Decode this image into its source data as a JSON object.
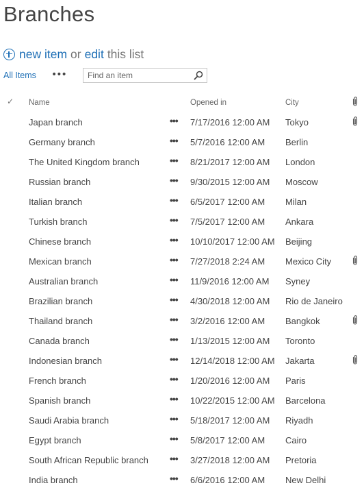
{
  "page": {
    "title": "Branches"
  },
  "commands": {
    "new_item": "new item",
    "or": "or",
    "edit": "edit",
    "this_list": "this list"
  },
  "views": {
    "all_items": "All Items",
    "more": "•••",
    "search_placeholder": "Find an item"
  },
  "columns": {
    "name": "Name",
    "opened_in": "Opened in",
    "city": "City"
  },
  "rows": [
    {
      "name": "Japan branch",
      "opened": "7/17/2016 12:00 AM",
      "city": "Tokyo",
      "attachment": true
    },
    {
      "name": "Germany branch",
      "opened": "5/7/2016 12:00 AM",
      "city": "Berlin",
      "attachment": false
    },
    {
      "name": "The United Kingdom branch",
      "opened": "8/21/2017 12:00 AM",
      "city": "London",
      "attachment": false
    },
    {
      "name": "Russian branch",
      "opened": "9/30/2015 12:00 AM",
      "city": "Moscow",
      "attachment": false
    },
    {
      "name": "Italian branch",
      "opened": "6/5/2017 12:00 AM",
      "city": "Milan",
      "attachment": false
    },
    {
      "name": "Turkish branch",
      "opened": "7/5/2017 12:00 AM",
      "city": "Ankara",
      "attachment": false
    },
    {
      "name": "Chinese branch",
      "opened": "10/10/2017 12:00 AM",
      "city": "Beijing",
      "attachment": false
    },
    {
      "name": "Mexican branch",
      "opened": "7/27/2018 2:24 AM",
      "city": "Mexico City",
      "attachment": true
    },
    {
      "name": "Australian branch",
      "opened": "11/9/2016 12:00 AM",
      "city": "Syney",
      "attachment": false
    },
    {
      "name": "Brazilian branch",
      "opened": "4/30/2018 12:00 AM",
      "city": "Rio de Janeiro",
      "attachment": false
    },
    {
      "name": "Thailand branch",
      "opened": "3/2/2016 12:00 AM",
      "city": "Bangkok",
      "attachment": true
    },
    {
      "name": "Canada branch",
      "opened": "1/13/2015 12:00 AM",
      "city": "Toronto",
      "attachment": false
    },
    {
      "name": "Indonesian branch",
      "opened": "12/14/2018 12:00 AM",
      "city": "Jakarta",
      "attachment": true
    },
    {
      "name": "French branch",
      "opened": "1/20/2016 12:00 AM",
      "city": "Paris",
      "attachment": false
    },
    {
      "name": "Spanish branch",
      "opened": "10/22/2015 12:00 AM",
      "city": "Barcelona",
      "attachment": false
    },
    {
      "name": "Saudi Arabia branch",
      "opened": "5/18/2017 12:00 AM",
      "city": "Riyadh",
      "attachment": false
    },
    {
      "name": "Egypt branch",
      "opened": "5/8/2017 12:00 AM",
      "city": "Cairo",
      "attachment": false
    },
    {
      "name": "South African Republic branch",
      "opened": "3/27/2018 12:00 AM",
      "city": "Pretoria",
      "attachment": false
    },
    {
      "name": "India branch",
      "opened": "6/6/2016 12:00 AM",
      "city": "New Delhi",
      "attachment": false
    }
  ],
  "row_more": "•••",
  "icons": {
    "new_item": "plus-circle-icon",
    "search": "search-icon",
    "select_all": "checkmark-icon",
    "attachment": "paperclip-icon"
  },
  "colors": {
    "link": "#1e6fb6",
    "text": "#444444",
    "muted": "#777777"
  }
}
